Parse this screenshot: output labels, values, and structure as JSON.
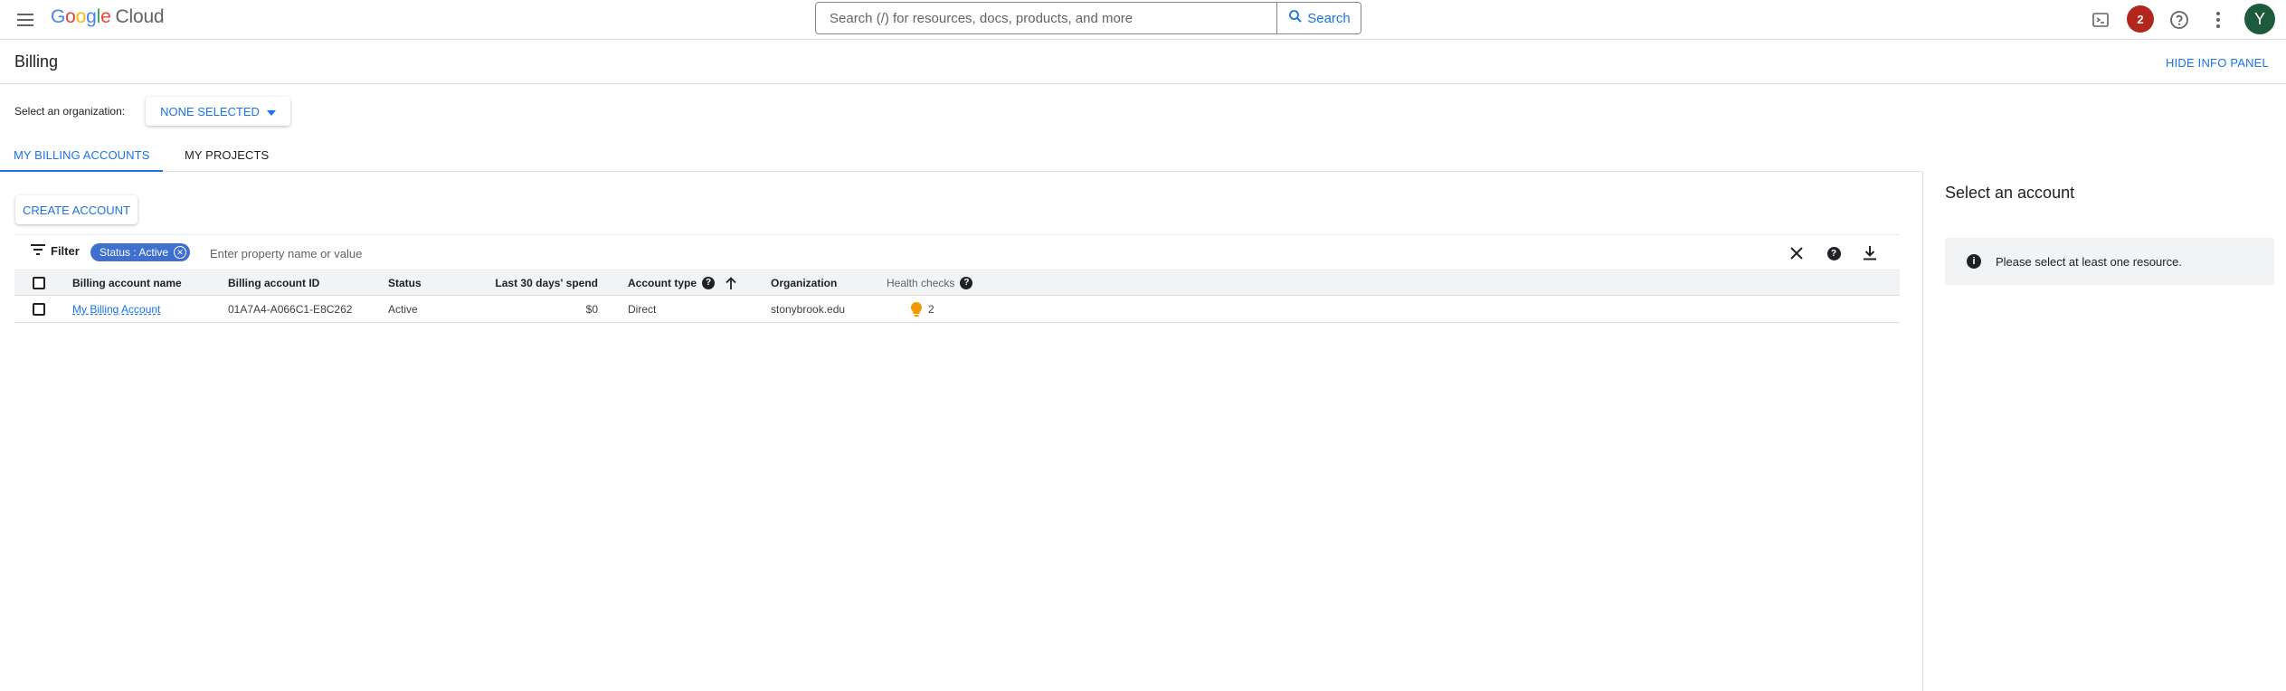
{
  "header": {
    "logo_letters": [
      "G",
      "o",
      "o",
      "g",
      "l",
      "e"
    ],
    "logo_suffix": "Cloud",
    "search_placeholder": "Search (/) for resources, docs, products, and more",
    "search_button": "Search",
    "notification_count": "2",
    "avatar_initial": "Y"
  },
  "page": {
    "title": "Billing",
    "hide_info_panel": "HIDE INFO PANEL"
  },
  "org": {
    "label": "Select an organization:",
    "selected": "NONE SELECTED"
  },
  "tabs": [
    {
      "label": "MY BILLING ACCOUNTS",
      "active": true
    },
    {
      "label": "MY PROJECTS",
      "active": false
    }
  ],
  "toolbar": {
    "create_account": "CREATE ACCOUNT"
  },
  "filter": {
    "label": "Filter",
    "chip": "Status : Active",
    "placeholder": "Enter property name or value"
  },
  "table": {
    "columns": {
      "name": "Billing account name",
      "id": "Billing account ID",
      "status": "Status",
      "spend": "Last 30 days' spend",
      "type": "Account type",
      "org": "Organization",
      "health": "Health checks"
    },
    "rows": [
      {
        "name": "My Billing Account",
        "id": "01A7A4-A066C1-E8C262",
        "status": "Active",
        "spend": "$0",
        "type": "Direct",
        "org": "stonybrook.edu",
        "health": "2"
      }
    ]
  },
  "info_panel": {
    "title": "Select an account",
    "message": "Please select at least one resource."
  },
  "colors": {
    "accent": "#1a73e8",
    "notification": "#b3261e",
    "avatar": "#1e5a3c",
    "chip": "#3f6fcf",
    "health_bulb": "#f29900"
  }
}
